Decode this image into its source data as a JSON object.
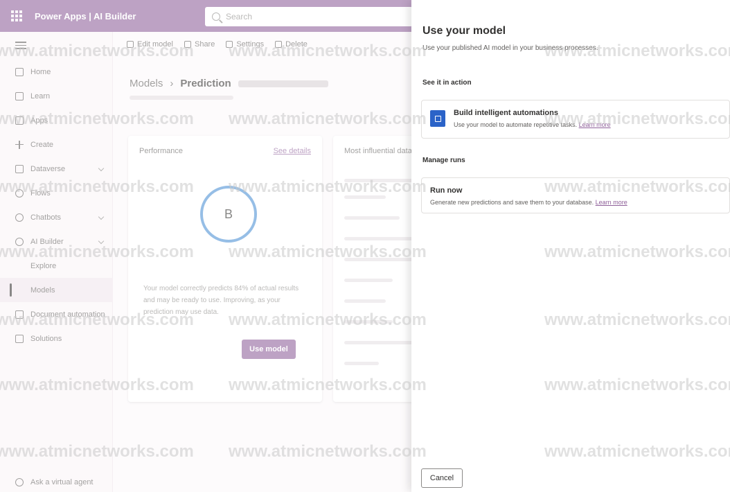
{
  "header": {
    "app_title": "Power Apps | AI Builder",
    "search_placeholder": "Search"
  },
  "sidebar": {
    "items": [
      {
        "label": "Home",
        "icon": "home-icon"
      },
      {
        "label": "Learn",
        "icon": "book-icon"
      },
      {
        "label": "Apps",
        "icon": "apps-icon"
      },
      {
        "label": "Create",
        "icon": "plus-icon"
      },
      {
        "label": "Dataverse",
        "icon": "database-icon"
      },
      {
        "label": "Flows",
        "icon": "flow-icon"
      },
      {
        "label": "Chatbots",
        "icon": "chatbot-icon"
      },
      {
        "label": "AI Builder",
        "icon": "ai-icon"
      }
    ],
    "sub_items": [
      "Explore",
      "Models"
    ],
    "more_items": [
      {
        "label": "Document automation",
        "icon": "document-icon"
      },
      {
        "label": "Solutions",
        "icon": "solutions-icon"
      }
    ],
    "bottom": "Ask a virtual agent"
  },
  "commands": [
    "Edit model",
    "Share",
    "Settings",
    "Delete"
  ],
  "breadcrumb": {
    "parent": "Models",
    "current": "Prediction"
  },
  "performance": {
    "title": "Performance",
    "link": "See details",
    "grade": "B",
    "text": "Your model correctly predicts 84% of actual results and may be ready to use. Improving, as your prediction may use data.",
    "button": "Use model"
  },
  "influence": {
    "title": "Most influential data"
  },
  "panel": {
    "title": "Use your model",
    "subtitle": "Use your published AI model in your business processes.",
    "section1": "See it in action",
    "option1": {
      "title": "Build intelligent automations",
      "desc": "Use your model to automate repetitive tasks.",
      "link": "Learn more"
    },
    "section2": "Manage runs",
    "option2": {
      "title": "Run now",
      "desc": "Generate new predictions and save them to your database.",
      "link": "Learn more"
    },
    "cancel": "Cancel"
  },
  "watermark": "www.atmicnetworks.com"
}
